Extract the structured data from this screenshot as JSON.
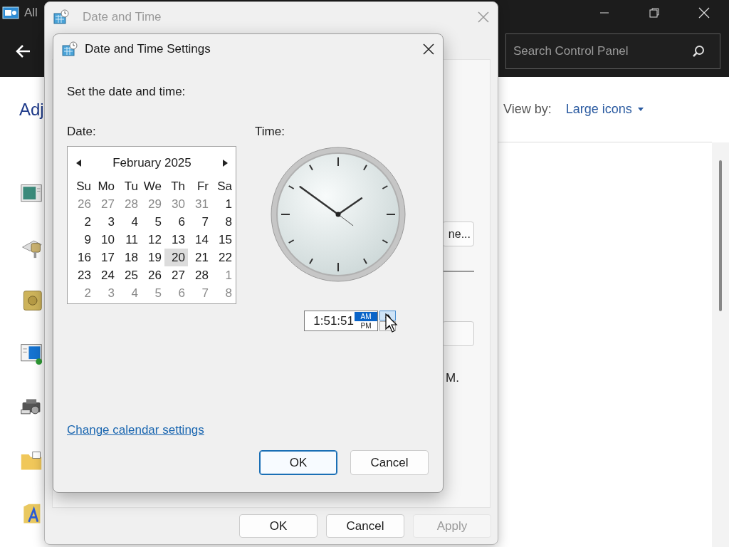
{
  "background_window": {
    "title": "All",
    "search": {
      "placeholder": "Search Control Panel"
    },
    "heading": "Adj",
    "view_by": {
      "label": "View by:",
      "value": "Large icons"
    }
  },
  "date_time_window": {
    "title": "Date and Time",
    "partial_button": "ne...",
    "partial_text": "M.",
    "buttons": [
      {
        "label": "OK",
        "disabled": false
      },
      {
        "label": "Cancel",
        "disabled": false
      },
      {
        "label": "Apply",
        "disabled": true
      }
    ]
  },
  "settings_dialog": {
    "title": "Date and Time Settings",
    "instruction": "Set the date and time:",
    "date_label": "Date:",
    "time_label": "Time:",
    "calendar": {
      "month": "February 2025",
      "weekdays": [
        "Su",
        "Mo",
        "Tu",
        "We",
        "Th",
        "Fr",
        "Sa"
      ],
      "weeks": [
        [
          {
            "day": "26",
            "in_month": false,
            "selected": false
          },
          {
            "day": "27",
            "in_month": false,
            "selected": false
          },
          {
            "day": "28",
            "in_month": false,
            "selected": false
          },
          {
            "day": "29",
            "in_month": false,
            "selected": false
          },
          {
            "day": "30",
            "in_month": false,
            "selected": false
          },
          {
            "day": "31",
            "in_month": false,
            "selected": false
          },
          {
            "day": "1",
            "in_month": true,
            "selected": false
          }
        ],
        [
          {
            "day": "2",
            "in_month": true,
            "selected": false
          },
          {
            "day": "3",
            "in_month": true,
            "selected": false
          },
          {
            "day": "4",
            "in_month": true,
            "selected": false
          },
          {
            "day": "5",
            "in_month": true,
            "selected": false
          },
          {
            "day": "6",
            "in_month": true,
            "selected": false
          },
          {
            "day": "7",
            "in_month": true,
            "selected": false
          },
          {
            "day": "8",
            "in_month": true,
            "selected": false
          }
        ],
        [
          {
            "day": "9",
            "in_month": true,
            "selected": false
          },
          {
            "day": "10",
            "in_month": true,
            "selected": false
          },
          {
            "day": "11",
            "in_month": true,
            "selected": false
          },
          {
            "day": "12",
            "in_month": true,
            "selected": false
          },
          {
            "day": "13",
            "in_month": true,
            "selected": false
          },
          {
            "day": "14",
            "in_month": true,
            "selected": false
          },
          {
            "day": "15",
            "in_month": true,
            "selected": false
          }
        ],
        [
          {
            "day": "16",
            "in_month": true,
            "selected": false
          },
          {
            "day": "17",
            "in_month": true,
            "selected": false
          },
          {
            "day": "18",
            "in_month": true,
            "selected": false
          },
          {
            "day": "19",
            "in_month": true,
            "selected": false
          },
          {
            "day": "20",
            "in_month": true,
            "selected": true
          },
          {
            "day": "21",
            "in_month": true,
            "selected": false
          },
          {
            "day": "22",
            "in_month": true,
            "selected": false
          }
        ],
        [
          {
            "day": "23",
            "in_month": true,
            "selected": false
          },
          {
            "day": "24",
            "in_month": true,
            "selected": false
          },
          {
            "day": "25",
            "in_month": true,
            "selected": false
          },
          {
            "day": "26",
            "in_month": true,
            "selected": false
          },
          {
            "day": "27",
            "in_month": true,
            "selected": false
          },
          {
            "day": "28",
            "in_month": true,
            "selected": false
          },
          {
            "day": "1",
            "in_month": false,
            "selected": false
          }
        ],
        [
          {
            "day": "2",
            "in_month": false,
            "selected": false
          },
          {
            "day": "3",
            "in_month": false,
            "selected": false
          },
          {
            "day": "4",
            "in_month": false,
            "selected": false
          },
          {
            "day": "5",
            "in_month": false,
            "selected": false
          },
          {
            "day": "6",
            "in_month": false,
            "selected": false
          },
          {
            "day": "7",
            "in_month": false,
            "selected": false
          },
          {
            "day": "8",
            "in_month": false,
            "selected": false
          }
        ]
      ]
    },
    "time": {
      "value": "1:51:51",
      "periods": [
        {
          "label": "AM",
          "selected": true
        },
        {
          "label": "PM",
          "selected": false
        }
      ]
    },
    "link": "Change calendar settings",
    "buttons": [
      {
        "label": "OK",
        "default": true
      },
      {
        "label": "Cancel",
        "default": false
      }
    ]
  }
}
